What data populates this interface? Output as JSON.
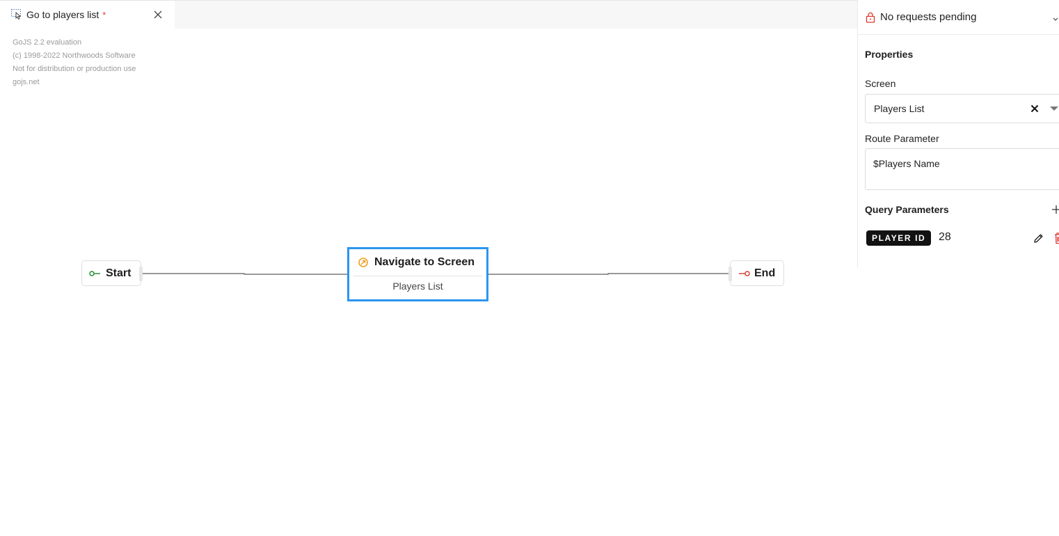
{
  "tab": {
    "title": "Go to players list",
    "dirty_marker": "*",
    "icon": "flow-cursor-icon"
  },
  "watermark": {
    "line1": "GoJS 2.2 evaluation",
    "line2": "(c) 1998-2022 Northwoods Software",
    "line3": "Not for distribution or production use",
    "line4": "gojs.net"
  },
  "diagram": {
    "start_label": "Start",
    "end_label": "End",
    "nav_node": {
      "title": "Navigate to Screen",
      "subtitle": "Players List"
    },
    "colors": {
      "selection": "#2b95f0",
      "start_port": "#1a8a2a",
      "end_port": "#d9362b",
      "nav_icon": "#f0a020"
    }
  },
  "panel": {
    "requests_status": "No requests pending",
    "properties_title": "Properties",
    "screen_label": "Screen",
    "screen_value": "Players List",
    "route_label": "Route Parameter",
    "route_value": "$Players Name",
    "query_title": "Query Parameters",
    "query_params": [
      {
        "key": "PLAYER ID",
        "value": "28"
      }
    ]
  }
}
